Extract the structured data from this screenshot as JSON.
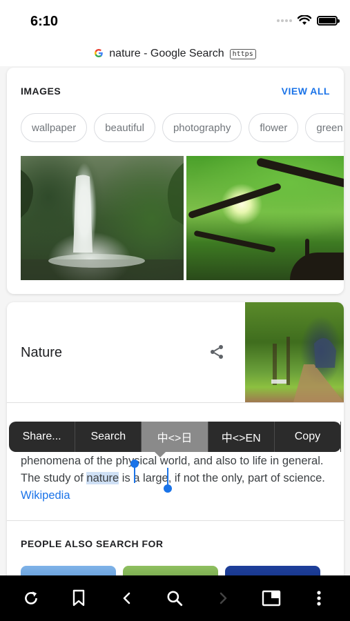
{
  "status": {
    "time": "6:10"
  },
  "url_bar": {
    "logo": "G",
    "title": "nature - Google Search",
    "badge": "https"
  },
  "images_card": {
    "header": "IMAGES",
    "view_all": "VIEW ALL",
    "chips": [
      "wallpaper",
      "beautiful",
      "photography",
      "flower",
      "green"
    ]
  },
  "nature_card": {
    "title": "Nature",
    "description_before": "phenomena of the physical world, and also to life in general. The study of ",
    "selected_word": "nature",
    "description_after": " is a large, if not the only, part of science. ",
    "source_link": "Wikipedia",
    "people_header": "PEOPLE ALSO SEARCH FOR"
  },
  "context_menu": {
    "items": [
      "Share...",
      "Search",
      "中<>日",
      "中<>EN",
      "Copy"
    ],
    "active_index": 2
  },
  "toolbar": {
    "icons": [
      "reload-icon",
      "bookmark-icon",
      "back-icon",
      "search-icon",
      "forward-icon",
      "tabs-icon",
      "more-icon"
    ]
  },
  "colors": {
    "accent": "#1a73e8",
    "menu_bg": "#2b2b2b",
    "menu_active": "#8a8a8a",
    "toolbar_bg": "#000000"
  }
}
